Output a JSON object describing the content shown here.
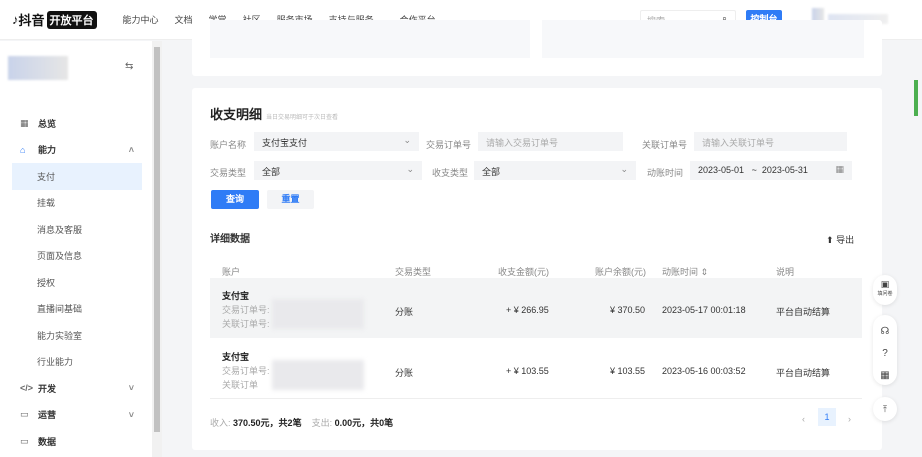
{
  "header": {
    "logo": "抖音",
    "logo_badge": "开放平台",
    "nav": [
      "能力中心",
      "文档",
      "学堂",
      "社区",
      "服务市场",
      "支持与服务",
      "合作平台"
    ],
    "search_placeholder": "搜索",
    "console": "控制台"
  },
  "sidebar": {
    "items": [
      {
        "label": "总览",
        "icon": "grid-icon",
        "type": "top"
      },
      {
        "label": "能力",
        "icon": "capability-icon",
        "type": "top",
        "expanded": true
      },
      {
        "label": "支付",
        "type": "sub",
        "selected": true
      },
      {
        "label": "挂载",
        "type": "sub"
      },
      {
        "label": "消息及客服",
        "type": "sub"
      },
      {
        "label": "页面及信息",
        "type": "sub"
      },
      {
        "label": "授权",
        "type": "sub"
      },
      {
        "label": "直播间基础",
        "type": "sub"
      },
      {
        "label": "能力实验室",
        "type": "sub"
      },
      {
        "label": "行业能力",
        "type": "sub"
      },
      {
        "label": "开发",
        "icon": "code-icon",
        "type": "top"
      },
      {
        "label": "运营",
        "icon": "monitor-icon",
        "type": "top"
      },
      {
        "label": "数据",
        "icon": "monitor-icon",
        "type": "top"
      }
    ]
  },
  "main": {
    "title": "收支明细",
    "subtitle": "当日交易明细可于次日查看",
    "filters": {
      "account_label": "账户名称",
      "account_value": "支付宝支付",
      "order_label": "交易订单号",
      "order_placeholder": "请输入交易订单号",
      "related_label": "关联订单号",
      "related_placeholder": "请输入关联订单号",
      "trade_type_label": "交易类型",
      "trade_type_value": "全部",
      "io_type_label": "收支类型",
      "io_type_value": "全部",
      "time_label": "动账时间",
      "date_from": "2023-05-01",
      "date_sep": "~",
      "date_to": "2023-05-31"
    },
    "query": "查询",
    "reset": "重置",
    "detail_title": "详细数据",
    "export": "导出",
    "columns": [
      "账户",
      "交易类型",
      "收支金额(元)",
      "账户余额(元)",
      "动账时间",
      "说明"
    ],
    "rows": [
      {
        "account": "支付宝",
        "order_label": "交易订单号:",
        "related_label": "关联订单号:",
        "type": "分账",
        "amount": "+ ¥ 266.95",
        "balance": "¥ 370.50",
        "time": "2023-05-17 00:01:18",
        "note": "平台自动结算"
      },
      {
        "account": "支付宝",
        "order_label": "交易订单号:",
        "related_label": "关联订单",
        "type": "分账",
        "amount": "+ ¥ 103.55",
        "balance": "¥ 103.55",
        "time": "2023-05-16 00:03:52",
        "note": "平台自动结算"
      }
    ],
    "footer": {
      "income_label": "收入:",
      "income": "370.50元，共2笔",
      "expense_label": "支出:",
      "expense": "0.00元，共0笔"
    },
    "page": "1"
  },
  "float": {
    "questionnaire": "填问卷"
  }
}
